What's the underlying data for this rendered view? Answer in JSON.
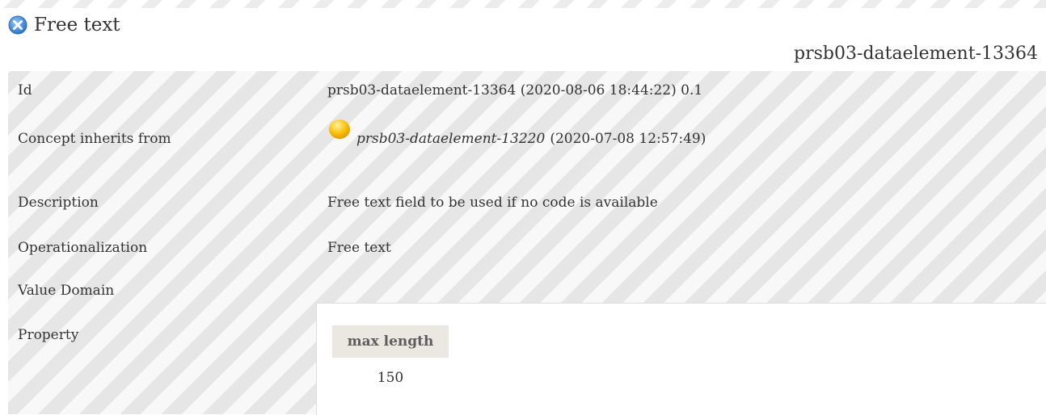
{
  "header": {
    "title": "Free text",
    "title_icon": "close-circle-icon",
    "concept_id": "prsb03-dataelement-13364"
  },
  "rows": {
    "id": {
      "label": "Id",
      "value": "prsb03-dataelement-13364 (2020-08-06 18:44:22) 0.1"
    },
    "inherits": {
      "label": "Concept inherits from",
      "icon": "yellow-circle-icon",
      "link": "prsb03-dataelement-13220",
      "date": "(2020-07-08 12:57:49)"
    },
    "description": {
      "label": "Description",
      "value": "Free text field to be used if no code is available"
    },
    "operationalization": {
      "label": "Operationalization",
      "value": "Free text"
    },
    "value_domain": {
      "label": "Value Domain"
    },
    "property": {
      "label": "Property",
      "header": "max length",
      "value": "150"
    }
  },
  "colors": {
    "title_icon": "#4a90d9",
    "inherit_icon": "#f5b800",
    "property_header_bg": "#ebe8e2"
  }
}
